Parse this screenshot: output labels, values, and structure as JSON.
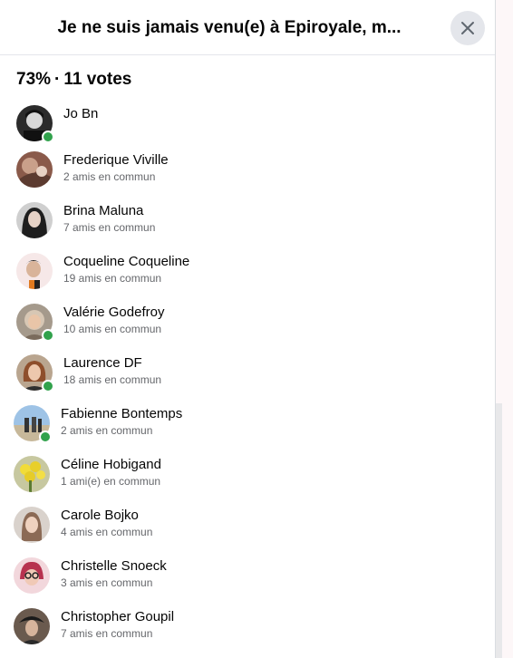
{
  "dialog": {
    "title": "Je ne suis jamais venu(e) à Epiroyale, m...",
    "close_icon": "close-icon"
  },
  "summary": {
    "percent": "73%",
    "separator": "·",
    "votes": "11 votes"
  },
  "voters": [
    {
      "name": "Jo Bn",
      "mutual": "",
      "online": true,
      "avatar": "avatar-photo"
    },
    {
      "name": "Frederique Viville",
      "mutual": "2 amis en commun",
      "online": false,
      "avatar": "avatar-photo"
    },
    {
      "name": "Brina Maluna",
      "mutual": "7 amis en commun",
      "online": false,
      "avatar": "avatar-photo"
    },
    {
      "name": "Coqueline Coqueline",
      "mutual": "19 amis en commun",
      "online": false,
      "avatar": "avatar-photo"
    },
    {
      "name": "Valérie Godefroy",
      "mutual": "10 amis en commun",
      "online": true,
      "avatar": "avatar-photo"
    },
    {
      "name": "Laurence DF",
      "mutual": "18 amis en commun",
      "online": true,
      "avatar": "avatar-photo"
    },
    {
      "name": "Fabienne Bontemps",
      "mutual": "2 amis en commun",
      "online": true,
      "avatar": "avatar-photo"
    },
    {
      "name": "Céline Hobigand",
      "mutual": "1 ami(e) en commun",
      "online": false,
      "avatar": "avatar-photo"
    },
    {
      "name": "Carole Bojko",
      "mutual": "4 amis en commun",
      "online": false,
      "avatar": "avatar-photo"
    },
    {
      "name": "Christelle Snoeck",
      "mutual": "3 amis en commun",
      "online": false,
      "avatar": "avatar-photo"
    },
    {
      "name": "Christopher Goupil",
      "mutual": "7 amis en commun",
      "online": false,
      "avatar": "avatar-photo"
    }
  ],
  "colors": {
    "online": "#31a24c",
    "secondary_text": "#65676b",
    "close_bg": "#e4e6eb"
  }
}
